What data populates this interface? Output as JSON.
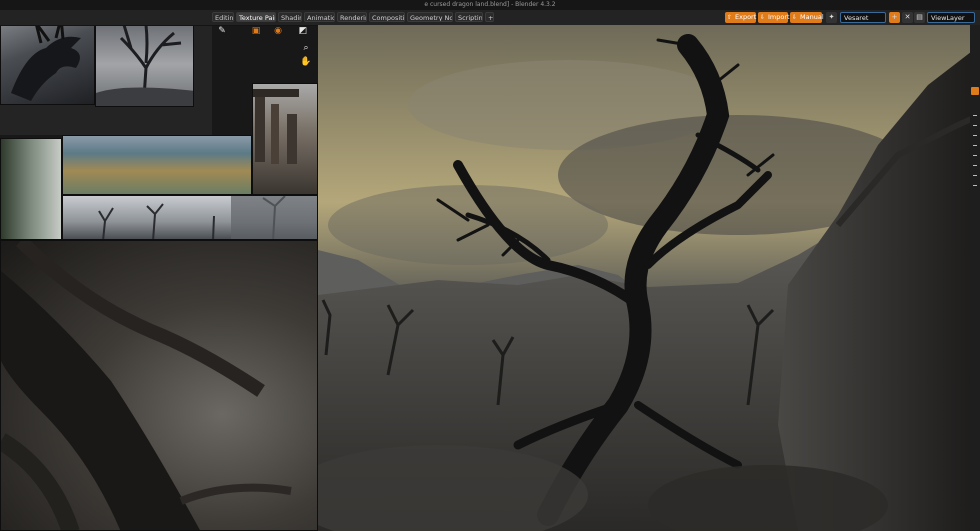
{
  "window": {
    "title": "e cursed dragon land.blend] - Blender 4.3.2"
  },
  "workspaces": [
    {
      "label": "Editing",
      "active": false
    },
    {
      "label": "Texture Paint",
      "active": true
    },
    {
      "label": "Shading",
      "active": false
    },
    {
      "label": "Animation",
      "active": false
    },
    {
      "label": "Rendering",
      "active": false
    },
    {
      "label": "Compositing",
      "active": false
    },
    {
      "label": "Geometry Nodes",
      "active": false
    },
    {
      "label": "Scripting",
      "active": false
    },
    {
      "label": "+",
      "active": false
    }
  ],
  "header": {
    "export_label": "Export",
    "import_label": "Import",
    "manual_label": "Manual",
    "scene_value": "Vesaret",
    "view_layer_value": "ViewLayer"
  },
  "colors": {
    "accent": "#e07b1a",
    "field_border": "#3a6a9a",
    "ui_dark": "#1d1d1d"
  },
  "reference_images": [
    {
      "name": "dragon-sketch"
    },
    {
      "name": "dead-tree-sketch"
    },
    {
      "name": "swamp-painting"
    },
    {
      "name": "ruins-painting"
    },
    {
      "name": "tree-detail"
    },
    {
      "name": "misty-trees-painting"
    },
    {
      "name": "twisted-trunk-closeup"
    }
  ]
}
